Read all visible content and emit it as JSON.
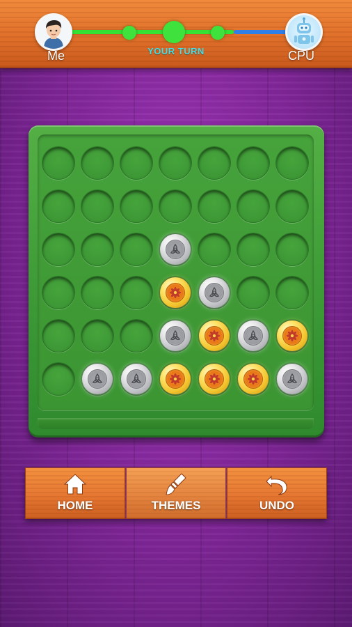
{
  "header": {
    "player_left": "Me",
    "player_right": "CPU",
    "turn_status": "YOUR TURN",
    "left_avatar_icon": "boy-avatar-icon",
    "right_avatar_icon": "robot-avatar-icon",
    "colors": {
      "progress": "#35e133",
      "opponent_track": "#2f7fe6",
      "turn_text": "#3ee0ea"
    }
  },
  "board": {
    "columns": 7,
    "rows": 6,
    "grid": [
      [
        "empty",
        "empty",
        "empty",
        "empty",
        "empty",
        "empty",
        "empty"
      ],
      [
        "empty",
        "empty",
        "empty",
        "empty",
        "empty",
        "empty",
        "empty"
      ],
      [
        "empty",
        "empty",
        "empty",
        "silver",
        "empty",
        "empty",
        "empty"
      ],
      [
        "empty",
        "empty",
        "empty",
        "gold",
        "silver",
        "empty",
        "empty"
      ],
      [
        "empty",
        "empty",
        "empty",
        "silver",
        "gold",
        "silver",
        "gold"
      ],
      [
        "empty",
        "silver",
        "silver",
        "gold",
        "gold",
        "gold",
        "silver"
      ]
    ],
    "piece_colors": {
      "gold": "#f2c32c",
      "silver": "#c4c5c9"
    }
  },
  "buttons": {
    "home_label": "HOME",
    "themes_label": "THEMES",
    "undo_label": "UNDO",
    "home_icon": "home-icon",
    "themes_icon": "brush-icon",
    "undo_icon": "undo-icon"
  }
}
